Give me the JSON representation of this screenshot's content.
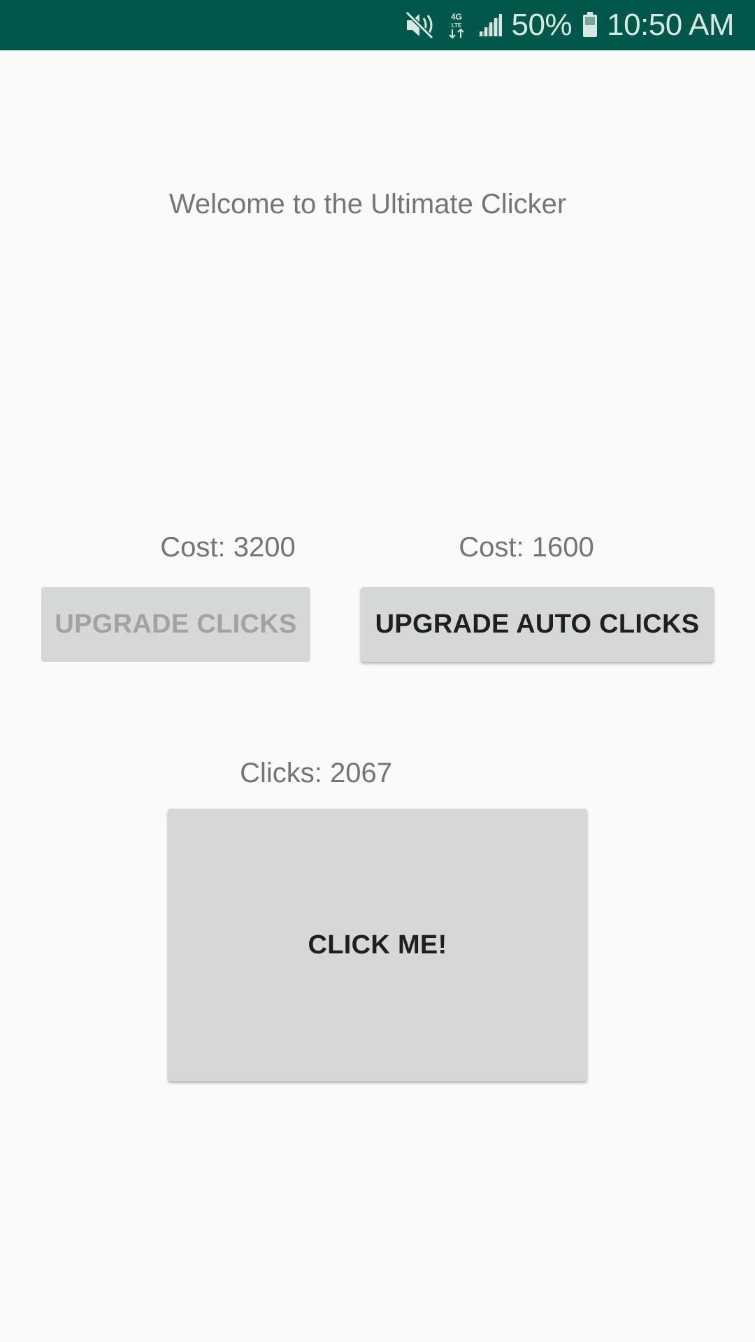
{
  "status_bar": {
    "battery_percent": "50%",
    "time": "10:50 AM",
    "network_label": "4G LTE",
    "icons": [
      "mute-icon",
      "network-4g-lte-icon",
      "signal-icon",
      "battery-icon"
    ],
    "background_color": "#01574a"
  },
  "main": {
    "welcome_text": "Welcome to the Ultimate Clicker",
    "upgrade_clicks": {
      "cost_label": "Cost: 3200",
      "button_label": "UPGRADE CLICKS",
      "enabled": false
    },
    "upgrade_auto_clicks": {
      "cost_label": "Cost: 1600",
      "button_label": "UPGRADE AUTO CLICKS",
      "enabled": true
    },
    "clicks_label": "Clicks: 2067",
    "click_button_label": "CLICK ME!"
  },
  "colors": {
    "background": "#fafafa",
    "button": "#d6d7d7",
    "label_text": "#757575",
    "disabled_text": "#a2a2a2"
  }
}
